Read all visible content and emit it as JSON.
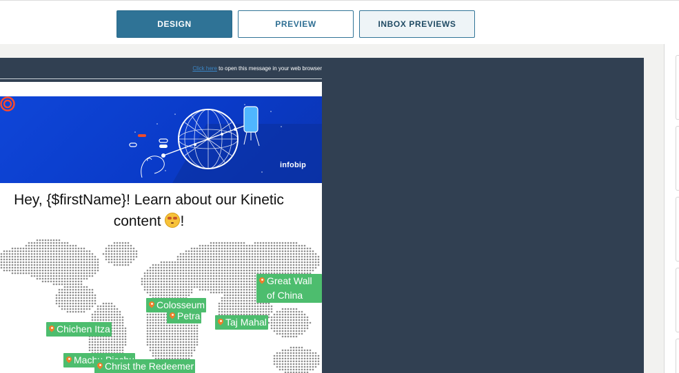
{
  "tabs": {
    "design": "DESIGN",
    "preview": "PREVIEW",
    "inbox_previews": "INBOX PREVIEWS"
  },
  "preheader": {
    "link_text": "Click here",
    "rest_text": " to open this message in your web browser"
  },
  "banner": {
    "brand": "infobip"
  },
  "heading": {
    "line1": "Hey, {$firstName}! Learn about our Kinetic",
    "line2_before": "content ",
    "line2_after": "!"
  },
  "map_pins": [
    "Great Wall of China",
    "Colosseum",
    "Petra",
    "Taj Mahal",
    "Chichen Itza",
    "Machu Picchu",
    "Christ the Redeemer"
  ],
  "colors": {
    "design_tab": "#2f7396",
    "email_background": "#314052",
    "banner_blue": "#0f46d8",
    "pin_green": "#4dbd6e",
    "pin_orange": "#ef7d2b"
  },
  "icons": [
    "infobip-logo-icon",
    "globe-illustration",
    "star-struck-emoji-icon",
    "map-pin-icon"
  ]
}
